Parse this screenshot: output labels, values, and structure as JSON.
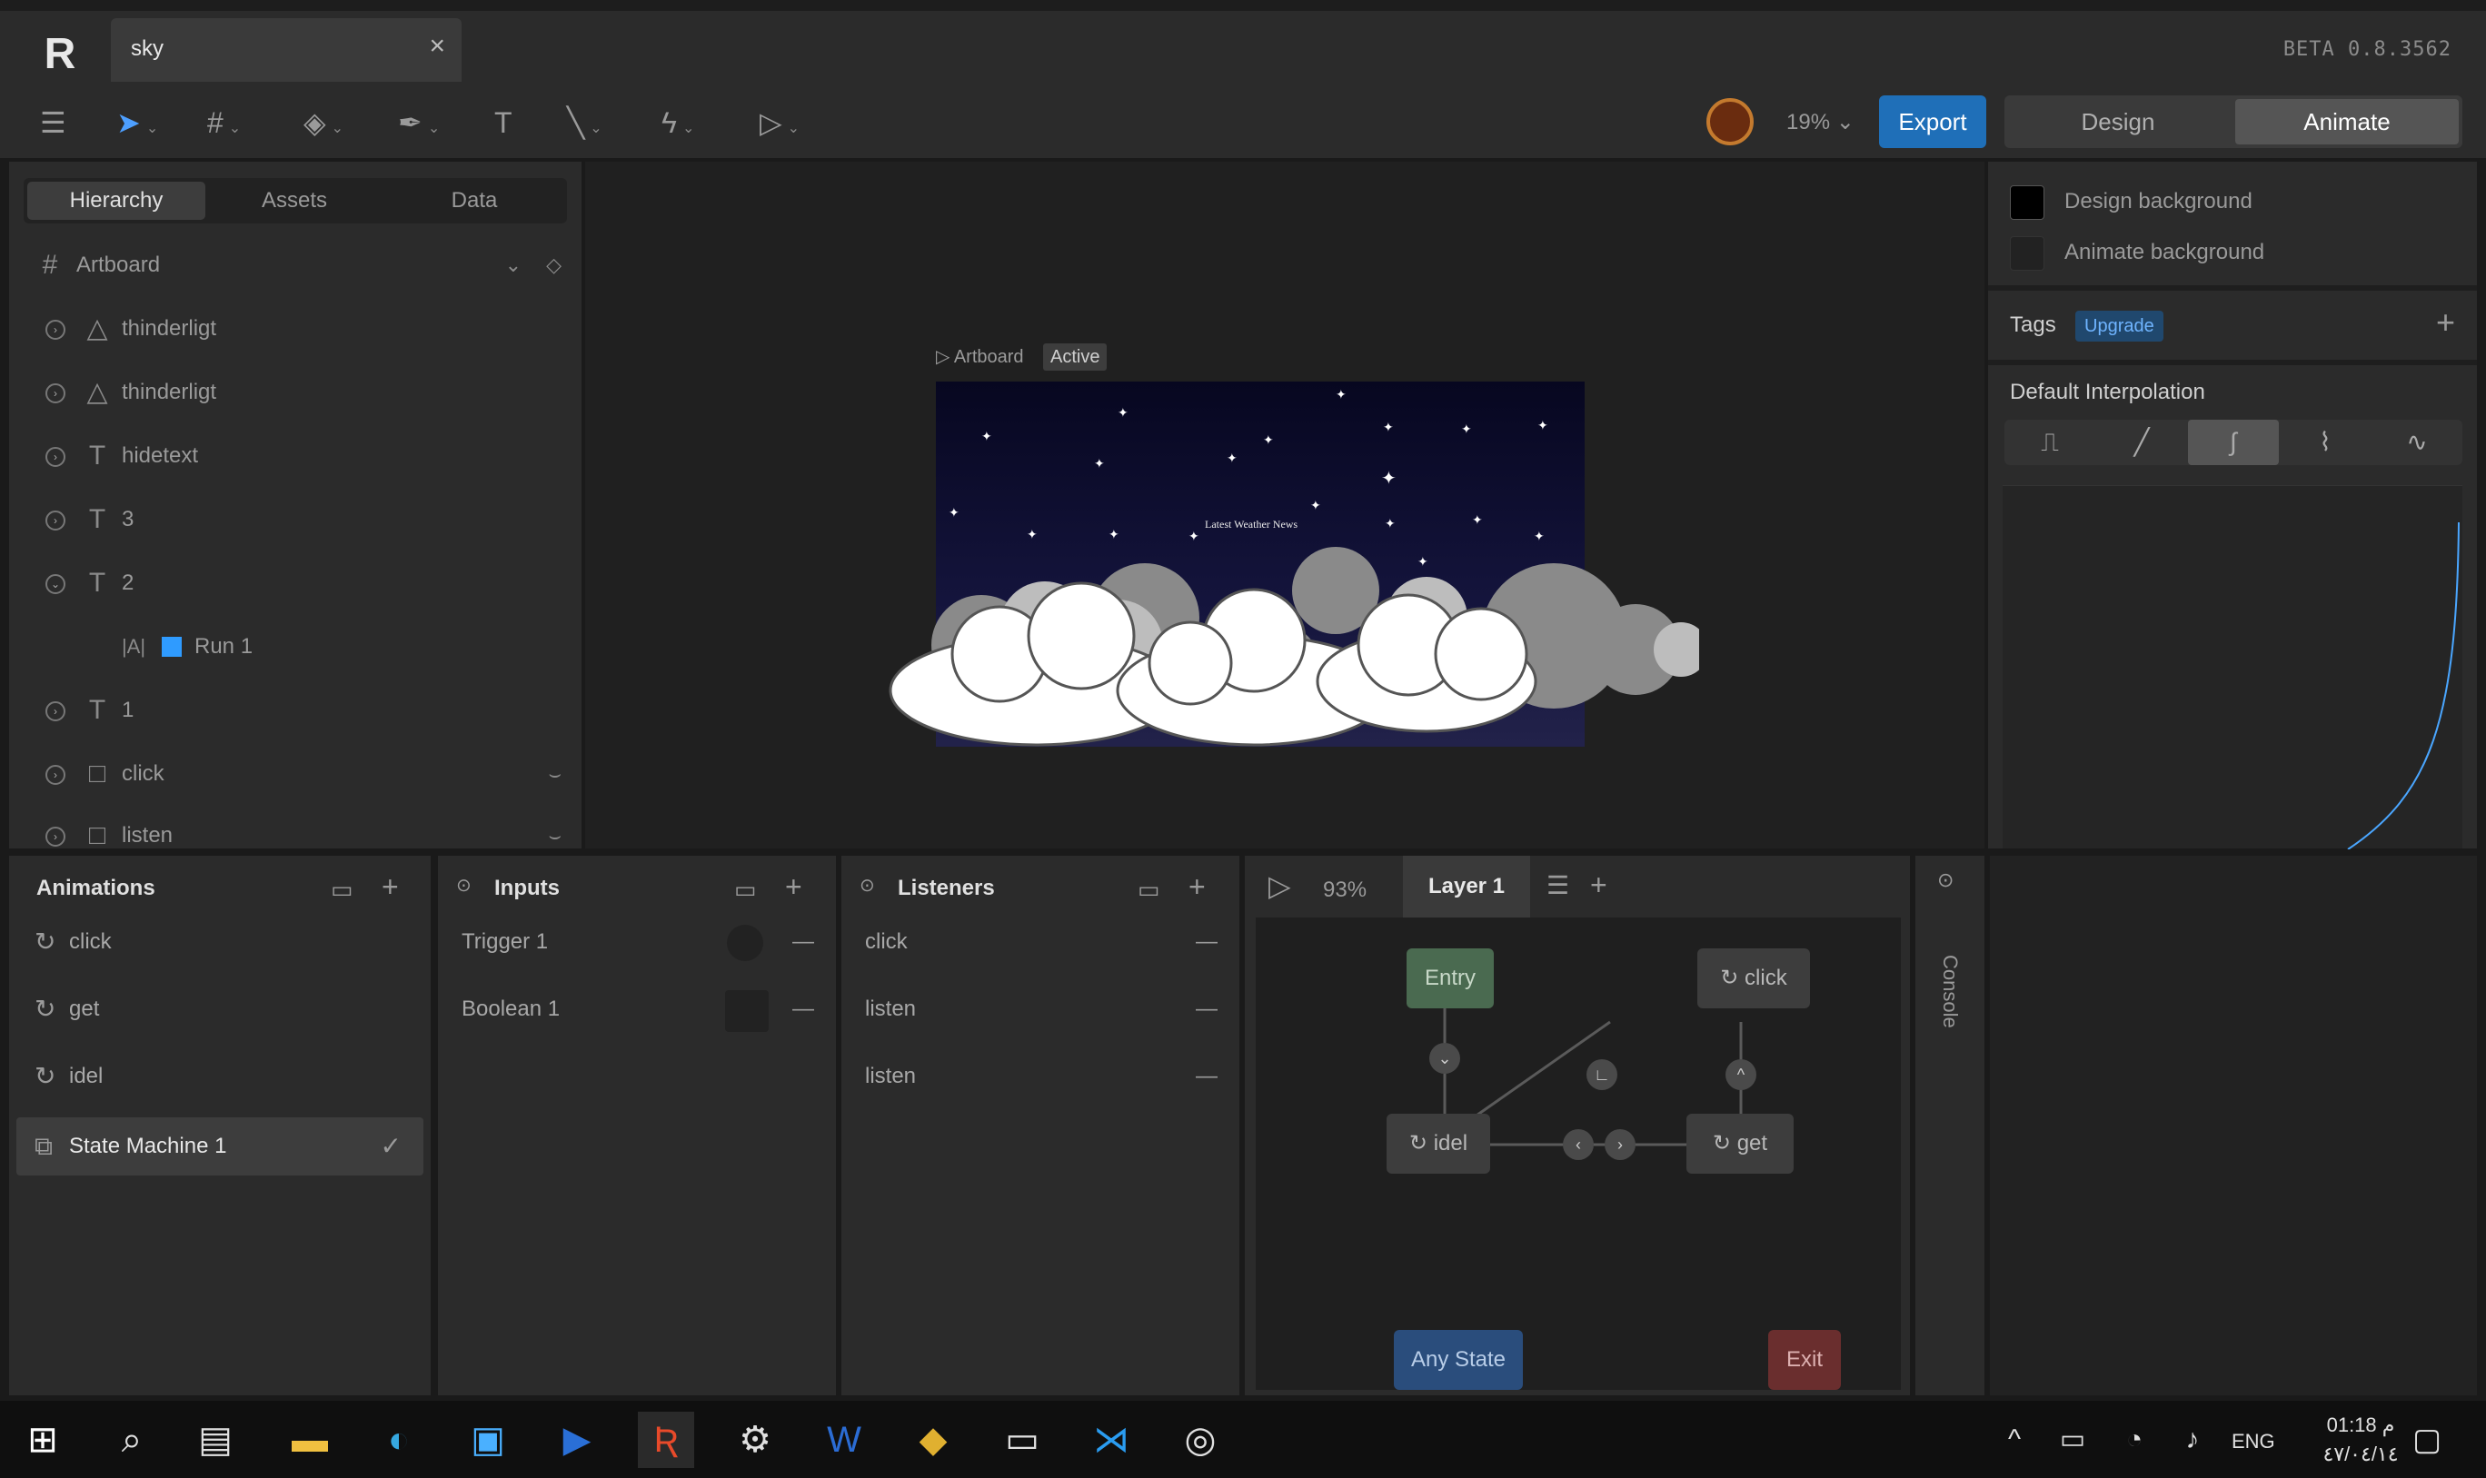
{
  "titlebar": {
    "tab_title": "sky",
    "version": "BETA 0.8.3562"
  },
  "toolbar": {
    "zoom": "19%",
    "export_label": "Export",
    "design_label": "Design",
    "animate_label": "Animate"
  },
  "hierarchy": {
    "tabs": [
      "Hierarchy",
      "Assets",
      "Data"
    ],
    "artboard": "Artboard",
    "rows": [
      {
        "name": "thinderligt",
        "icon": "triangle-icon"
      },
      {
        "name": "thinderligt",
        "icon": "triangle-icon"
      },
      {
        "name": "hidetext",
        "icon": "text-icon"
      },
      {
        "name": "3",
        "icon": "text-icon"
      },
      {
        "name": "2",
        "icon": "text-icon"
      },
      {
        "name": "Run 1",
        "icon": "text-run-icon"
      },
      {
        "name": "1",
        "icon": "text-icon"
      },
      {
        "name": "click",
        "icon": "rectangle-icon"
      },
      {
        "name": "listen",
        "icon": "rectangle-icon"
      }
    ]
  },
  "canvas": {
    "artboard_label": "Artboard",
    "active_badge": "Active",
    "news_text": "Latest Weather News"
  },
  "inspector": {
    "design_bg": "Design background",
    "animate_bg": "Animate background",
    "tags": "Tags",
    "upgrade": "Upgrade",
    "default_interpolation": "Default Interpolation"
  },
  "animations": {
    "title": "Animations",
    "items": [
      "click",
      "get",
      "idel",
      "State Machine 1"
    ]
  },
  "inputs": {
    "title": "Inputs",
    "items": [
      "Trigger 1",
      "Boolean 1"
    ]
  },
  "listeners": {
    "title": "Listeners",
    "items": [
      "click",
      "listen",
      "listen"
    ]
  },
  "state_machine": {
    "zoom": "93%",
    "layer": "Layer 1",
    "nodes": {
      "entry": "Entry",
      "click": "click",
      "idel": "idel",
      "get": "get",
      "any_state": "Any State",
      "exit": "Exit"
    }
  },
  "console_label": "Console",
  "taskbar": {
    "lang": "ENG",
    "time": "01:18 م",
    "date": "٤٧/٠٤/١٤"
  }
}
